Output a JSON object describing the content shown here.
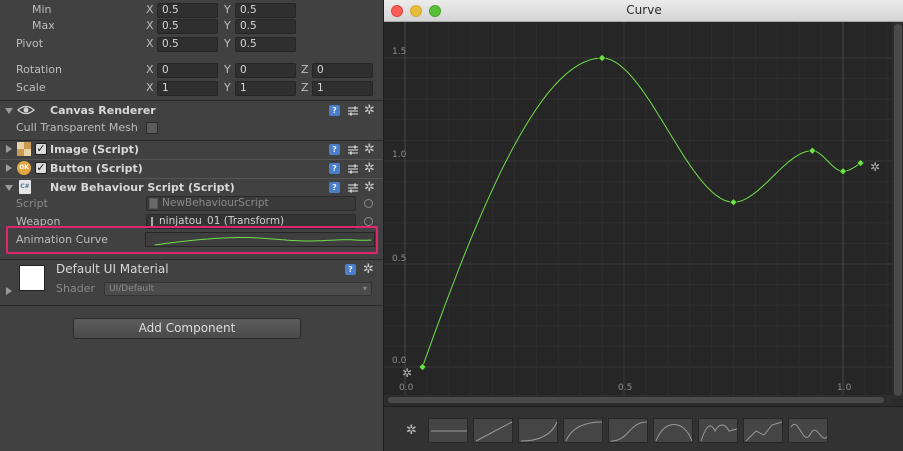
{
  "inspector": {
    "anchors": {
      "min_label": "Min",
      "max_label": "Max",
      "pivot_label": "Pivot",
      "min": {
        "x": "0.5",
        "y": "0.5"
      },
      "max": {
        "x": "0.5",
        "y": "0.5"
      },
      "pivot": {
        "x": "0.5",
        "y": "0.5"
      }
    },
    "axis_labels": {
      "x": "X",
      "y": "Y",
      "z": "Z"
    },
    "rotation": {
      "label": "Rotation",
      "x": "0",
      "y": "0",
      "z": "0"
    },
    "scale": {
      "label": "Scale",
      "x": "1",
      "y": "1",
      "z": "1"
    },
    "canvas_renderer": {
      "title": "Canvas Renderer",
      "cull_label": "Cull Transparent Mesh"
    },
    "image_component": {
      "title": "Image (Script)"
    },
    "button_component": {
      "title": "Button (Script)"
    },
    "behaviour": {
      "title": "New Behaviour Script (Script)",
      "script_label": "Script",
      "script_value": "NewBehaviourScript",
      "weapon_label": "Weapon",
      "weapon_value": "ninjatou_01 (Transform)",
      "curve_label": "Animation Curve"
    },
    "material": {
      "title": "Default UI Material",
      "shader_label": "Shader",
      "shader_value": "UI/Default"
    },
    "add_component": "Add Component",
    "help_glyph": "?",
    "check_glyph": "✓",
    "ok_badge": "OK",
    "cs_badge": "C#",
    "gear_glyph": "✲"
  },
  "curve_window": {
    "title": "Curve",
    "traffic_colors": [
      "#fc5b57",
      "#e5bf3c",
      "#57c038"
    ],
    "accent_green": "#6fe04a",
    "y_ticks": [
      "1.5",
      "1.0",
      "0.5",
      "0.0"
    ],
    "x_ticks": [
      "0.0",
      "0.5",
      "1.0"
    ],
    "keyframes": [
      {
        "t": 0.04,
        "v": 0.0
      },
      {
        "t": 0.45,
        "v": 1.5
      },
      {
        "t": 0.75,
        "v": 0.8
      },
      {
        "t": 0.93,
        "v": 1.05
      },
      {
        "t": 1.0,
        "v": 0.95
      },
      {
        "t": 1.04,
        "v": 0.99
      }
    ],
    "preset_count": 9
  },
  "highlight_color": "#e0266d"
}
